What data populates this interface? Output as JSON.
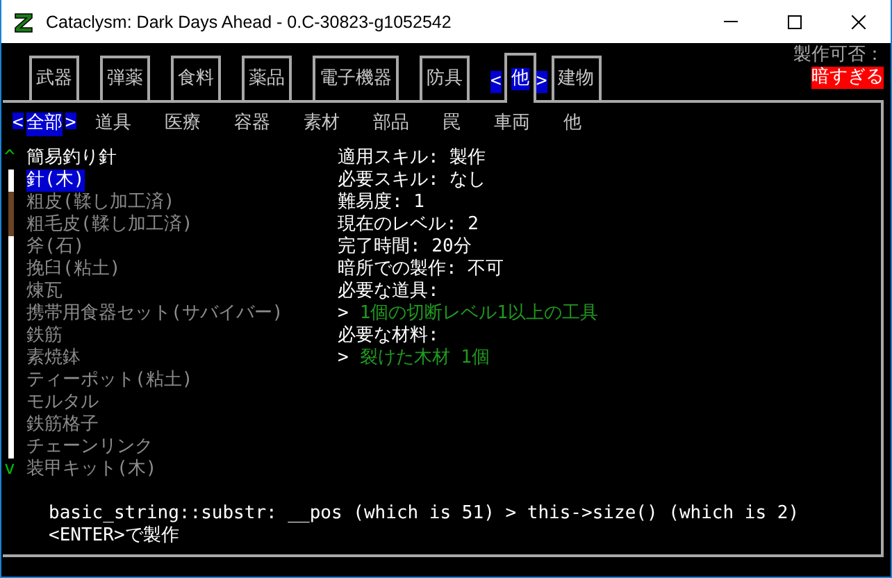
{
  "window": {
    "title": "Cataclysm: Dark Days Ahead - 0.C-30823-g1052542"
  },
  "category_tabs": [
    {
      "label": "武器",
      "selected": false
    },
    {
      "label": "弾薬",
      "selected": false
    },
    {
      "label": "食料",
      "selected": false
    },
    {
      "label": "薬品",
      "selected": false
    },
    {
      "label": "電子機器",
      "selected": false
    },
    {
      "label": "防具",
      "selected": false
    },
    {
      "label": "他",
      "selected": true
    },
    {
      "label": "建物",
      "selected": false
    }
  ],
  "tab_arrows": {
    "left": "<",
    "right": ">"
  },
  "craft_status": {
    "label": "製作可否：",
    "value": "暗すぎる"
  },
  "subcategory_tabs": [
    {
      "label": "全部",
      "selected": true
    },
    {
      "label": "道具",
      "selected": false
    },
    {
      "label": "医療",
      "selected": false
    },
    {
      "label": "容器",
      "selected": false
    },
    {
      "label": "素材",
      "selected": false
    },
    {
      "label": "部品",
      "selected": false
    },
    {
      "label": "罠",
      "selected": false
    },
    {
      "label": "車両",
      "selected": false
    },
    {
      "label": "他",
      "selected": false
    }
  ],
  "scrollbar": {
    "up": "^",
    "down": "v"
  },
  "recipes": [
    {
      "name": "簡易釣り針",
      "selected": false,
      "available": true
    },
    {
      "name": "針(木)",
      "selected": true,
      "available": true
    },
    {
      "name": "粗皮(鞣し加工済)",
      "selected": false,
      "available": false
    },
    {
      "name": "粗毛皮(鞣し加工済)",
      "selected": false,
      "available": false
    },
    {
      "name": "斧(石)",
      "selected": false,
      "available": false
    },
    {
      "name": "挽臼(粘土)",
      "selected": false,
      "available": false
    },
    {
      "name": "煉瓦",
      "selected": false,
      "available": false
    },
    {
      "name": "携帯用食器セット(サバイバー)",
      "selected": false,
      "available": false
    },
    {
      "name": "鉄筋",
      "selected": false,
      "available": false
    },
    {
      "name": "素焼鉢",
      "selected": false,
      "available": false
    },
    {
      "name": "ティーポット(粘土)",
      "selected": false,
      "available": false
    },
    {
      "name": "モルタル",
      "selected": false,
      "available": false
    },
    {
      "name": "鉄筋格子",
      "selected": false,
      "available": false
    },
    {
      "name": "チェーンリンク",
      "selected": false,
      "available": false
    },
    {
      "name": "装甲キット(木)",
      "selected": false,
      "available": false
    }
  ],
  "details": [
    {
      "kind": "line",
      "text": "適用スキル: 製作"
    },
    {
      "kind": "line",
      "text": "必要スキル: なし"
    },
    {
      "kind": "line",
      "text": "難易度: 1"
    },
    {
      "kind": "line",
      "text": "現在のレベル: 2"
    },
    {
      "kind": "line",
      "text": "完了時間: 20分"
    },
    {
      "kind": "line",
      "text": "暗所での製作: 不可"
    },
    {
      "kind": "line",
      "text": "必要な道具:"
    },
    {
      "kind": "requirement",
      "marker": ">",
      "text": "1個の切断レベル1以上の工具"
    },
    {
      "kind": "line",
      "text": "必要な材料:"
    },
    {
      "kind": "requirement",
      "marker": ">",
      "text": "裂けた木材 1個"
    }
  ],
  "messages": {
    "error": "basic_string::substr: __pos (which is 51) > this->size() (which is 2)",
    "hint": "<ENTER>で製作"
  }
}
